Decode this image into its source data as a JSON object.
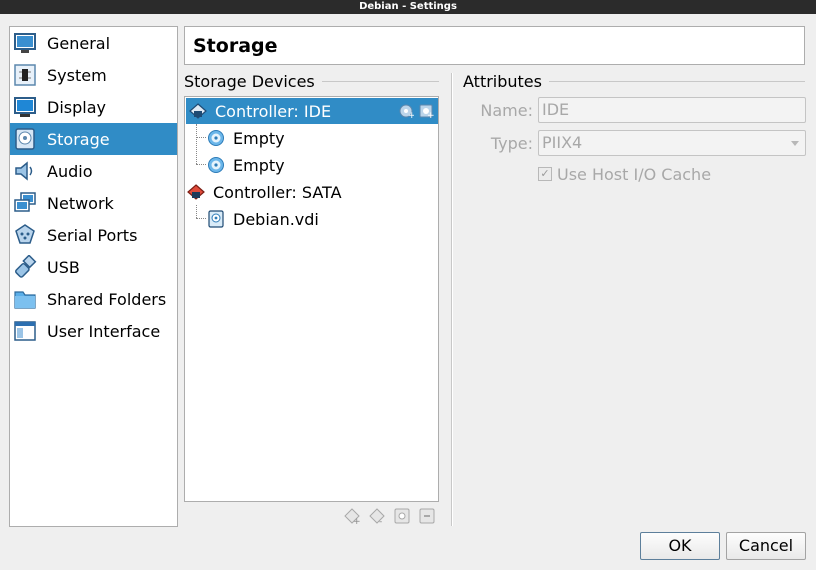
{
  "window": {
    "title": "Debian - Settings"
  },
  "sidebar": {
    "items": [
      {
        "label": "General",
        "icon": "general-icon"
      },
      {
        "label": "System",
        "icon": "system-icon"
      },
      {
        "label": "Display",
        "icon": "display-icon"
      },
      {
        "label": "Storage",
        "icon": "storage-icon",
        "selected": true
      },
      {
        "label": "Audio",
        "icon": "audio-icon"
      },
      {
        "label": "Network",
        "icon": "network-icon"
      },
      {
        "label": "Serial Ports",
        "icon": "serial-ports-icon"
      },
      {
        "label": "USB",
        "icon": "usb-icon"
      },
      {
        "label": "Shared Folders",
        "icon": "shared-folders-icon"
      },
      {
        "label": "User Interface",
        "icon": "user-interface-icon"
      }
    ]
  },
  "page": {
    "title": "Storage"
  },
  "storage_devices": {
    "label": "Storage Devices",
    "tree": [
      {
        "label": "Controller: IDE",
        "type": "controller",
        "selected": true
      },
      {
        "label": "Empty",
        "type": "optical"
      },
      {
        "label": "Empty",
        "type": "optical"
      },
      {
        "label": "Controller: SATA",
        "type": "controller"
      },
      {
        "label": "Debian.vdi",
        "type": "disk"
      }
    ],
    "toolbar": [
      "add-controller-icon",
      "remove-controller-icon",
      "add-attachment-icon",
      "remove-attachment-icon"
    ]
  },
  "attributes": {
    "label": "Attributes",
    "name_label": "Name:",
    "name_value": "IDE",
    "type_label": "Type:",
    "type_value": "PIIX4",
    "host_cache_label": "Use Host I/O Cache",
    "host_cache_checked": true
  },
  "buttons": {
    "ok": "OK",
    "cancel": "Cancel"
  },
  "colors": {
    "selection": "#308cc6",
    "titlebar": "#2b2b2b"
  }
}
